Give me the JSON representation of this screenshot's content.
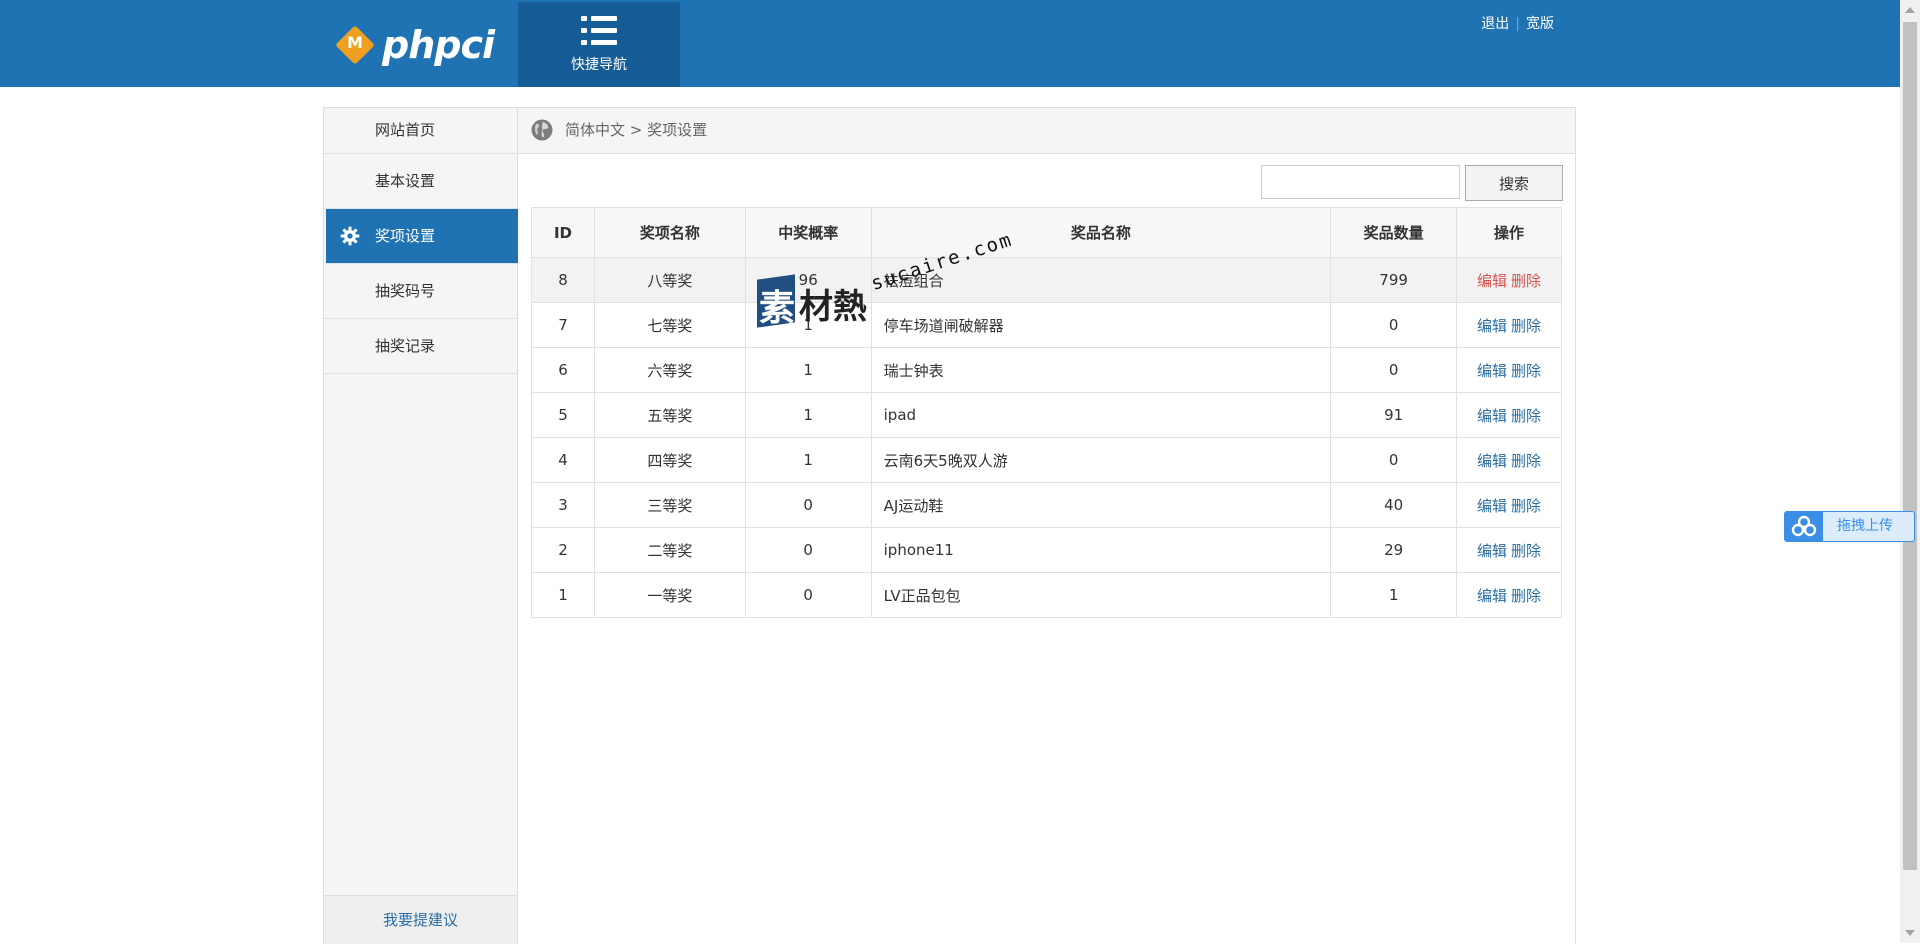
{
  "header": {
    "logo_text": "phpci",
    "logo_mark": "M",
    "quicknav_label": "快捷导航",
    "quicknav_icon": "list-icon",
    "links": {
      "logout": "退出",
      "wide": "宽版"
    }
  },
  "sidebar": {
    "items": [
      {
        "label": "网站首页"
      },
      {
        "label": "基本设置"
      },
      {
        "label": "奖项设置",
        "icon": "gear-icon",
        "active": true
      },
      {
        "label": "抽奖码号"
      },
      {
        "label": "抽奖记录"
      }
    ],
    "suggest": "我要提建议"
  },
  "breadcrumb": {
    "icon": "globe-icon",
    "text": "简体中文 > 奖项设置"
  },
  "search": {
    "value": "",
    "button": "搜索"
  },
  "table": {
    "headers": [
      "ID",
      "奖项名称",
      "中奖概率",
      "奖品名称",
      "奖品数量",
      "操作"
    ],
    "rows": [
      {
        "id": "8",
        "name": "八等奖",
        "prob": "96",
        "prize": "祛痘组合",
        "qty": "799"
      },
      {
        "id": "7",
        "name": "七等奖",
        "prob": "1",
        "prize": "停车场道闸破解器",
        "qty": "0"
      },
      {
        "id": "6",
        "name": "六等奖",
        "prob": "1",
        "prize": "瑞士钟表",
        "qty": "0"
      },
      {
        "id": "5",
        "name": "五等奖",
        "prob": "1",
        "prize": "ipad",
        "qty": "91"
      },
      {
        "id": "4",
        "name": "四等奖",
        "prob": "1",
        "prize": "云南6天5晚双人游",
        "qty": "0"
      },
      {
        "id": "3",
        "name": "三等奖",
        "prob": "0",
        "prize": "AJ运动鞋",
        "qty": "40"
      },
      {
        "id": "2",
        "name": "二等奖",
        "prob": "0",
        "prize": "iphone11",
        "qty": "29"
      },
      {
        "id": "1",
        "name": "一等奖",
        "prob": "0",
        "prize": "LV正品包包",
        "qty": "1"
      }
    ],
    "edit_label": "编辑",
    "delete_label": "删除"
  },
  "watermark": {
    "big": "素材熱",
    "url": "sucaire.com"
  },
  "upload_float": {
    "label": "拖拽上传",
    "icon": "cloud-icon"
  },
  "colors": {
    "primary": "#2073b3",
    "nav_dark": "#165d97",
    "link": "#2b6ea5",
    "danger": "#d9534f"
  }
}
